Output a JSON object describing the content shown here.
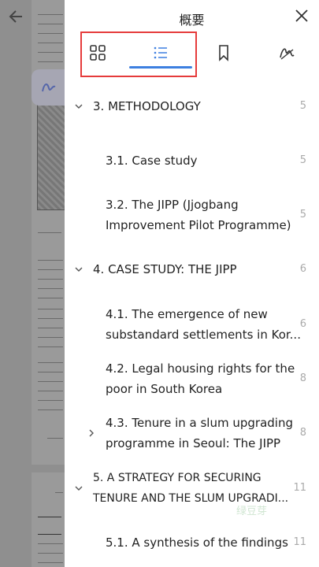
{
  "panel": {
    "title": "概要",
    "tabs": [
      {
        "name": "thumbnails",
        "icon": "grid-icon"
      },
      {
        "name": "outline",
        "icon": "list-icon",
        "active": true
      },
      {
        "name": "bookmarks",
        "icon": "bookmark-icon"
      },
      {
        "name": "annotations",
        "icon": "signature-icon"
      }
    ],
    "accent_color": "#3d7fe0",
    "highlight_color": "#e53b3b"
  },
  "outline": [
    {
      "label": "3. METHODOLOGY",
      "page": "5",
      "level": 1,
      "expander": "expanded"
    },
    {
      "label": "3.1. Case study",
      "page": "5",
      "level": 2
    },
    {
      "label_lines": [
        "3.2. The JIPP (Jjogbang",
        "Improvement Pilot Programme)"
      ],
      "page": "5",
      "level": 2
    },
    {
      "label": "4. CASE STUDY: THE JIPP",
      "page": "6",
      "level": 1,
      "expander": "expanded"
    },
    {
      "label_lines": [
        "4.1. The emergence of new",
        "substandard settlements in Kor..."
      ],
      "page": "6",
      "level": 2
    },
    {
      "label_lines": [
        "4.2. Legal housing rights for the",
        "poor in South Korea"
      ],
      "page": "8",
      "level": 2
    },
    {
      "label_lines": [
        "4.3. Tenure in a slum upgrading",
        "programme in Seoul: The JIPP"
      ],
      "page": "8",
      "level": 2,
      "expander": "collapsed"
    },
    {
      "label_lines": [
        "5. A STRATEGY FOR SECURING",
        "TENURE AND THE SLUM UPGRADI..."
      ],
      "page": "11",
      "level": 1,
      "expander": "expanded"
    },
    {
      "label": "5.1. A synthesis of the findings",
      "page": "11",
      "level": 2
    }
  ],
  "watermark": "绿豆芽"
}
